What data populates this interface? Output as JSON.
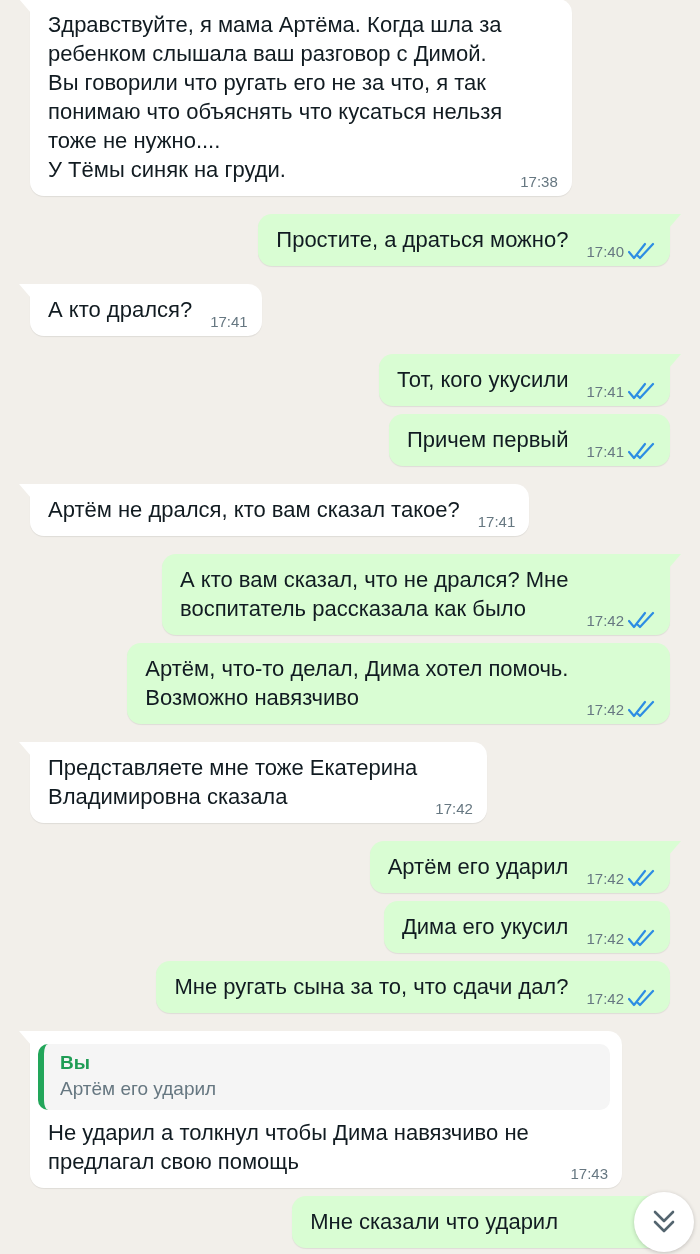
{
  "messages": [
    {
      "kind": "incoming",
      "tail": true,
      "text": "Здравствуйте, я мама Артёма. Когда шла за\nребенком слышала ваш разговор с Димой.\nВы говорили что ругать его не за что, я так\nпонимаю что объяснять что кусаться нельзя\nтоже не нужно....\nУ Тёмы синяк на груди.",
      "time": "17:38"
    },
    {
      "kind": "outgoing",
      "tail": true,
      "text": "Простите, а драться можно?",
      "time": "17:40",
      "read": true
    },
    {
      "kind": "incoming",
      "tail": true,
      "text": "А кто дрался?",
      "time": "17:41"
    },
    {
      "kind": "outgoing",
      "tail": true,
      "text": "Тот, кого укусили",
      "time": "17:41",
      "read": true
    },
    {
      "kind": "outgoing",
      "tail": false,
      "text": "Причем первый",
      "time": "17:41",
      "read": true
    },
    {
      "kind": "incoming",
      "tail": true,
      "text": "Артём не дрался, кто вам сказал такое?",
      "time": "17:41"
    },
    {
      "kind": "outgoing",
      "tail": true,
      "text": "А кто вам сказал, что не дрался? Мне\nвоспитатель рассказала как было",
      "time": "17:42",
      "read": true
    },
    {
      "kind": "outgoing",
      "tail": false,
      "text": "Артём, что-то делал, Дима хотел помочь.\nВозможно навязчиво",
      "time": "17:42",
      "read": true
    },
    {
      "kind": "incoming",
      "tail": true,
      "text": "Представляете мне тоже Екатерина\nВладимировна сказала",
      "time": "17:42"
    },
    {
      "kind": "outgoing",
      "tail": true,
      "text": "Артём его ударил",
      "time": "17:42",
      "read": true
    },
    {
      "kind": "outgoing",
      "tail": false,
      "text": "Дима его укусил",
      "time": "17:42",
      "read": true
    },
    {
      "kind": "outgoing",
      "tail": false,
      "text": "Мне ругать сына за то, что сдачи дал?",
      "time": "17:42",
      "read": true
    },
    {
      "kind": "incoming",
      "tail": true,
      "reply": {
        "author": "Вы",
        "text": "Артём его ударил"
      },
      "text": "Не ударил а толкнул чтобы Дима навязчиво не\nпредлагал свою помощь",
      "time": "17:43"
    },
    {
      "kind": "outgoing",
      "tail": false,
      "text": "Мне сказали что ударил"
    }
  ]
}
